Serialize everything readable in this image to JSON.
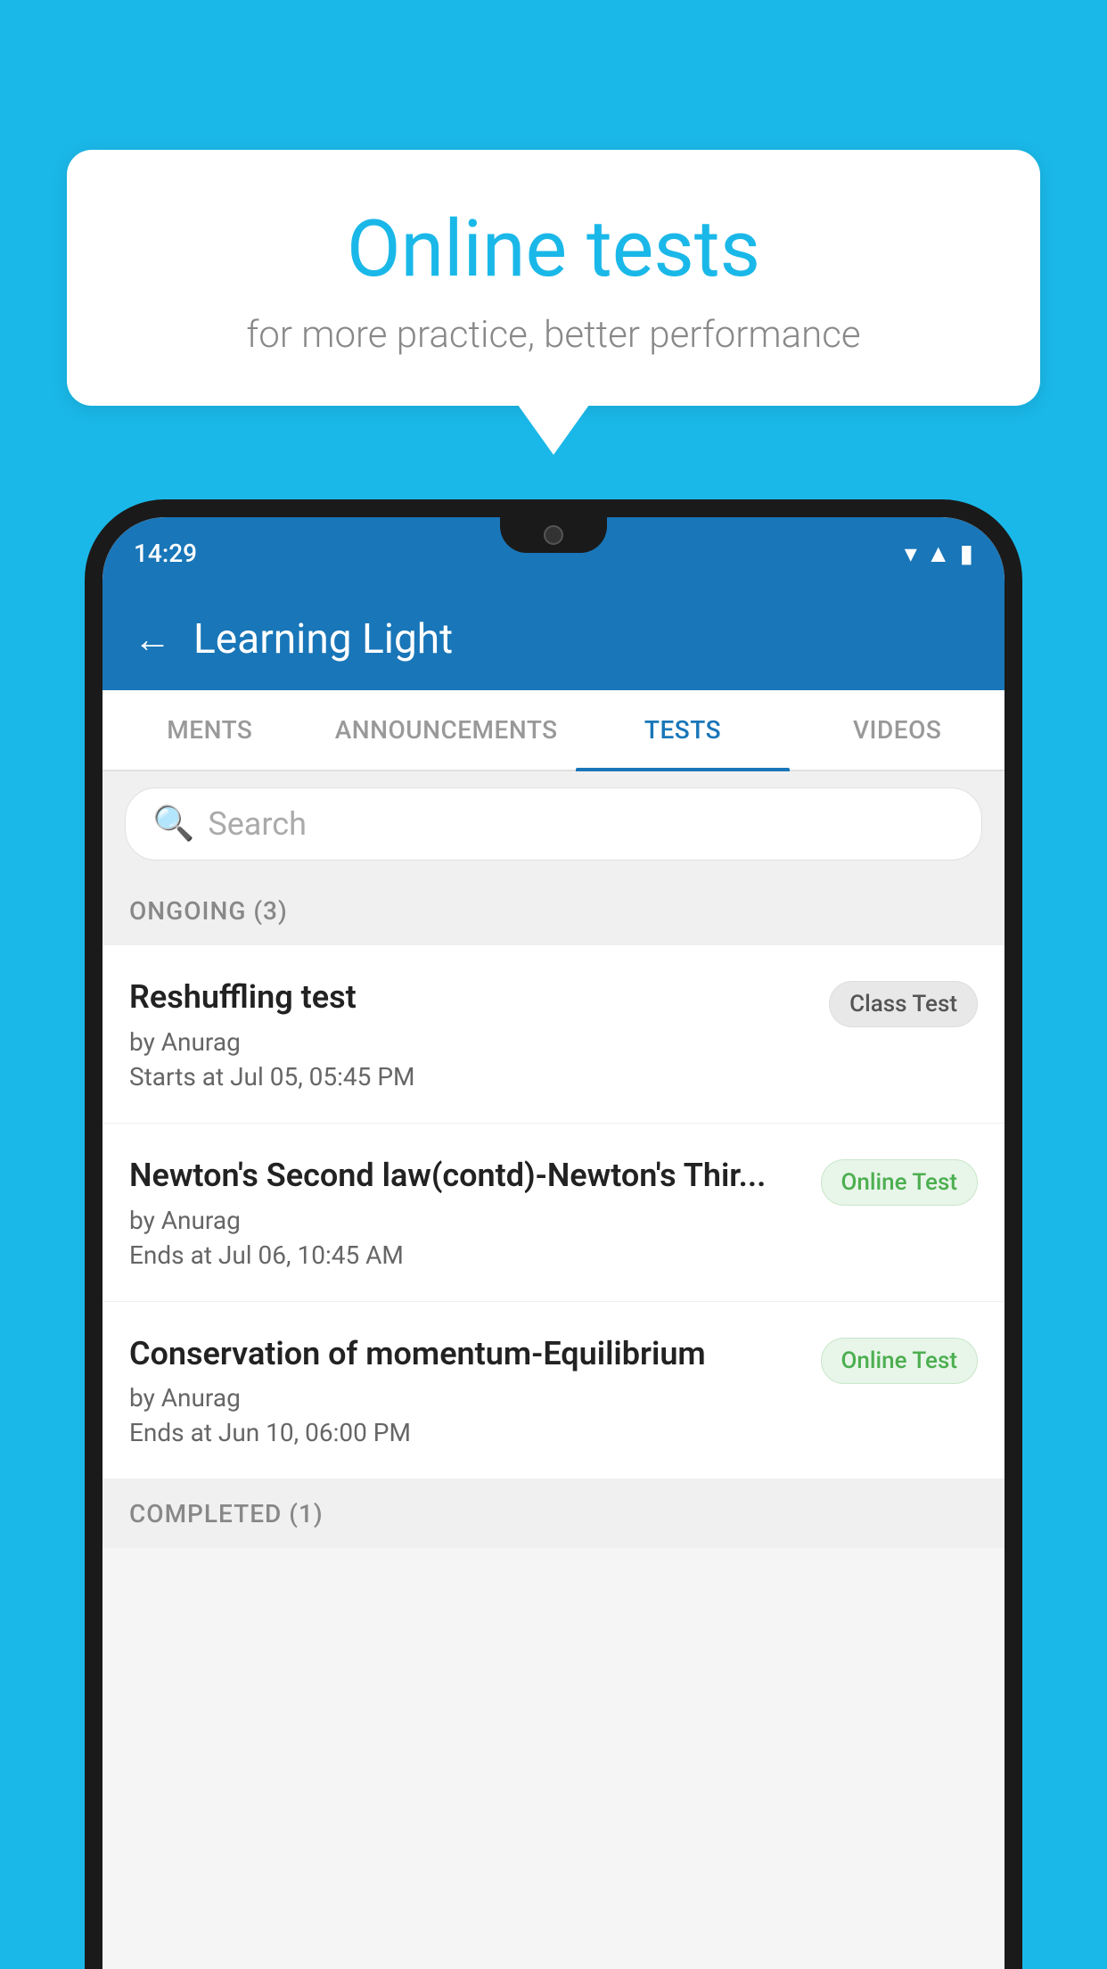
{
  "background_color": "#1ab8e8",
  "bubble": {
    "title": "Online tests",
    "subtitle": "for more practice, better performance"
  },
  "phone": {
    "status_bar": {
      "time": "14:29",
      "wifi": "▾",
      "signal": "▲",
      "battery": "▮"
    },
    "header": {
      "title": "Learning Light",
      "back_label": "←"
    },
    "tabs": [
      {
        "label": "MENTS",
        "active": false
      },
      {
        "label": "ANNOUNCEMENTS",
        "active": false
      },
      {
        "label": "TESTS",
        "active": true
      },
      {
        "label": "VIDEOS",
        "active": false
      }
    ],
    "search": {
      "placeholder": "Search"
    },
    "sections": [
      {
        "title": "ONGOING (3)",
        "tests": [
          {
            "name": "Reshuffling test",
            "by": "by Anurag",
            "time": "Starts at  Jul 05, 05:45 PM",
            "badge": "Class Test",
            "badge_type": "class"
          },
          {
            "name": "Newton's Second law(contd)-Newton's Thir...",
            "by": "by Anurag",
            "time": "Ends at  Jul 06, 10:45 AM",
            "badge": "Online Test",
            "badge_type": "online"
          },
          {
            "name": "Conservation of momentum-Equilibrium",
            "by": "by Anurag",
            "time": "Ends at  Jun 10, 06:00 PM",
            "badge": "Online Test",
            "badge_type": "online"
          }
        ]
      }
    ],
    "completed_section": {
      "title": "COMPLETED (1)"
    }
  }
}
